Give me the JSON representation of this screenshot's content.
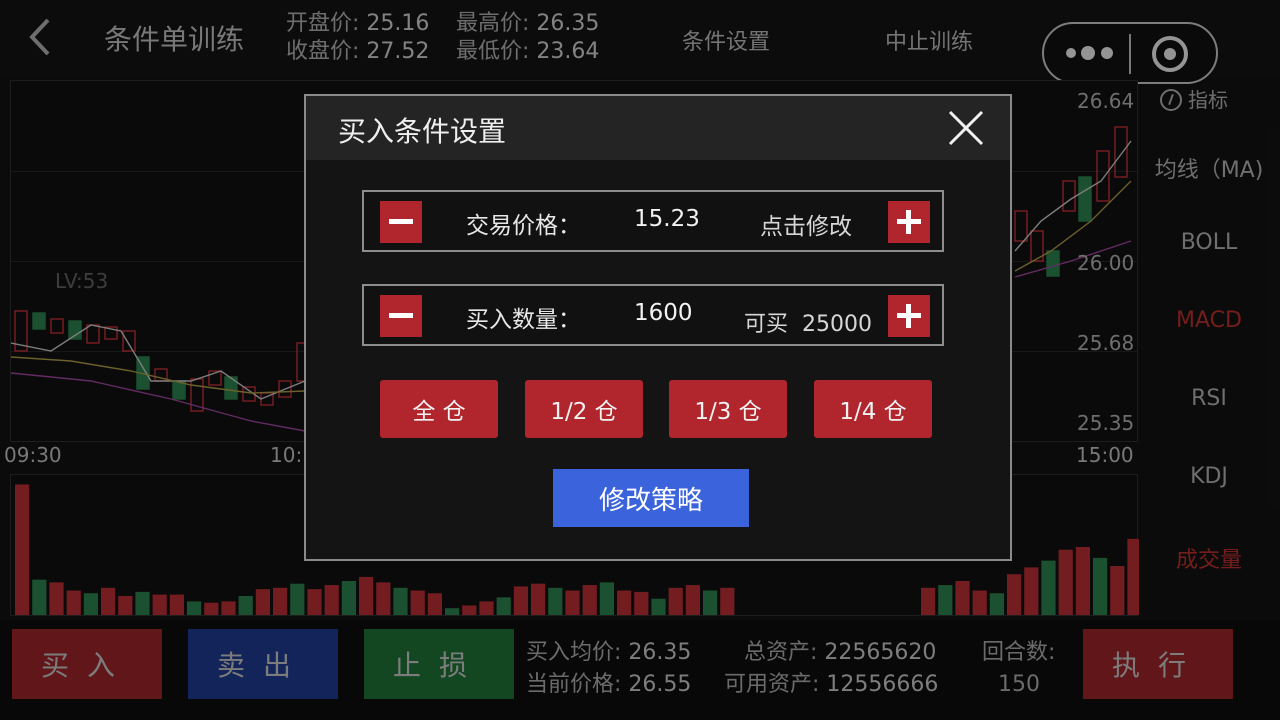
{
  "header": {
    "title": "条件单训练",
    "open_label": "开盘价:",
    "open_value": "25.16",
    "close_label": "收盘价:",
    "close_value": "27.52",
    "high_label": "最高价:",
    "high_value": "26.35",
    "low_label": "最低价:",
    "low_value": "23.64",
    "condition_settings": "条件设置",
    "stop_training": "中止训练"
  },
  "chart": {
    "y_ticks": [
      "26.64",
      "26.00",
      "25.68",
      "25.35"
    ],
    "indicator_text": "LV:53",
    "time_labels": [
      "09:30",
      "10:",
      "15:00"
    ],
    "volume_heights": [
      0.96,
      0.26,
      0.24,
      0.18,
      0.16,
      0.2,
      0.14,
      0.17,
      0.15,
      0.15,
      0.1,
      0.09,
      0.1,
      0.14,
      0.19,
      0.2,
      0.23,
      0.19,
      0.22,
      0.25,
      0.28,
      0.24,
      0.2,
      0.18,
      0.16,
      0.05,
      0.07,
      0.1,
      0.13,
      0.21,
      0.23,
      0.2,
      0.18,
      0.22,
      0.24,
      0.18,
      0.17,
      0.12,
      0.2,
      0.22,
      0.18,
      0.2
    ],
    "volume_heights_right": [
      0.2,
      0.22,
      0.25,
      0.18,
      0.16,
      0.3,
      0.35,
      0.4,
      0.48,
      0.5,
      0.42,
      0.36,
      0.56
    ],
    "volume_colors": [
      "#c8323a",
      "#2f8a54"
    ],
    "up_color": "#c8323a",
    "down_color": "#2f8a54"
  },
  "indicators": {
    "head": "指标",
    "items": [
      "均线（MA)",
      "BOLL",
      "MACD",
      "RSI",
      "KDJ",
      "成交量"
    ],
    "active": [
      "MACD",
      "成交量"
    ]
  },
  "actions": {
    "buy": "买入",
    "sell": "卖出",
    "stop_loss": "止损",
    "execute": "执行"
  },
  "stats": {
    "avg_buy_label": "买入均价:",
    "avg_buy_value": "26.35",
    "current_price_label": "当前价格:",
    "current_price_value": "26.55",
    "total_assets_label": "总资产:",
    "total_assets_value": "22565620",
    "available_label": "可用资产:",
    "available_value": "12556666",
    "rounds_label": "回合数:",
    "rounds_value": "150"
  },
  "modal": {
    "title": "买入条件设置",
    "price_label": "交易价格：",
    "price_value": "15.23",
    "price_hint": "点击修改",
    "qty_label": "买入数量：",
    "qty_value": "1600",
    "can_buy_label": "可买",
    "can_buy_value": "25000",
    "position_buttons": [
      "全 仓",
      "1/2 仓",
      "1/3 仓",
      "1/4 仓"
    ],
    "submit": "修改策略"
  },
  "colors": {
    "red": "#b1252d",
    "blue": "#3b63dc",
    "buy_bg": "#a8262b",
    "sell_bg": "#1f3f9a",
    "stop_bg": "#1f7a3a"
  }
}
